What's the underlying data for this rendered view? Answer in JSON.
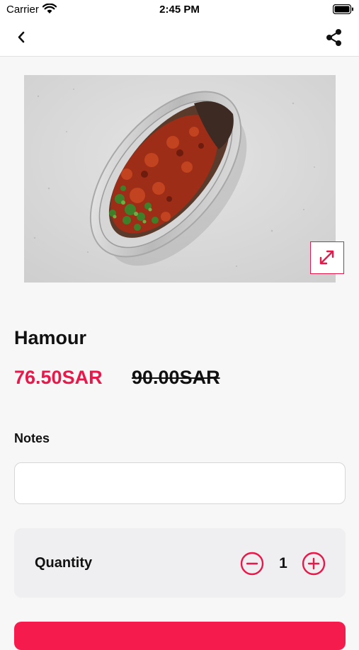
{
  "status_bar": {
    "carrier": "Carrier",
    "time": "2:45 PM"
  },
  "nav": {
    "back_icon": "chevron-left-icon",
    "share_icon": "share-icon"
  },
  "product": {
    "name": "Hamour",
    "price_current": "76.50SAR",
    "price_original": "90.00SAR",
    "image_subject": "grilled fish dish in foil tray",
    "expand_icon": "expand-arrows-icon"
  },
  "notes": {
    "label": "Notes",
    "value": "",
    "placeholder": ""
  },
  "quantity": {
    "label": "Quantity",
    "value": "1"
  },
  "colors": {
    "accent": "#e8194a",
    "button": "#f51c4d",
    "background": "#f7f7f7"
  }
}
